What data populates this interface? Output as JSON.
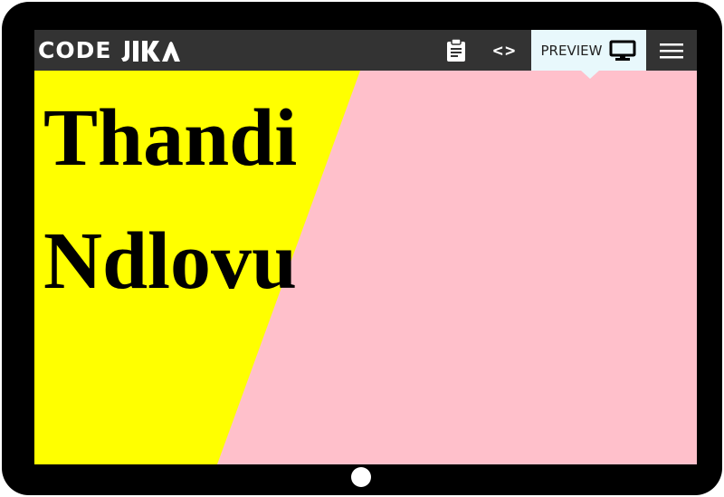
{
  "toolbar": {
    "brand_text": "CODE",
    "brand_logo": "jika-logo",
    "preview_label": "PREVIEW",
    "icons": {
      "clipboard": "clipboard-icon",
      "code": "code-icon",
      "monitor": "monitor-icon",
      "menu": "menu-icon"
    },
    "code_glyph": "<>"
  },
  "content": {
    "first_name": "Thandi",
    "last_name": "Ndlovu"
  },
  "colors": {
    "toolbar": "#333333",
    "preview_tab": "#e8f8fc",
    "background_left": "#ffff00",
    "background_right": "#ffc0cb",
    "device_frame": "#000000"
  }
}
